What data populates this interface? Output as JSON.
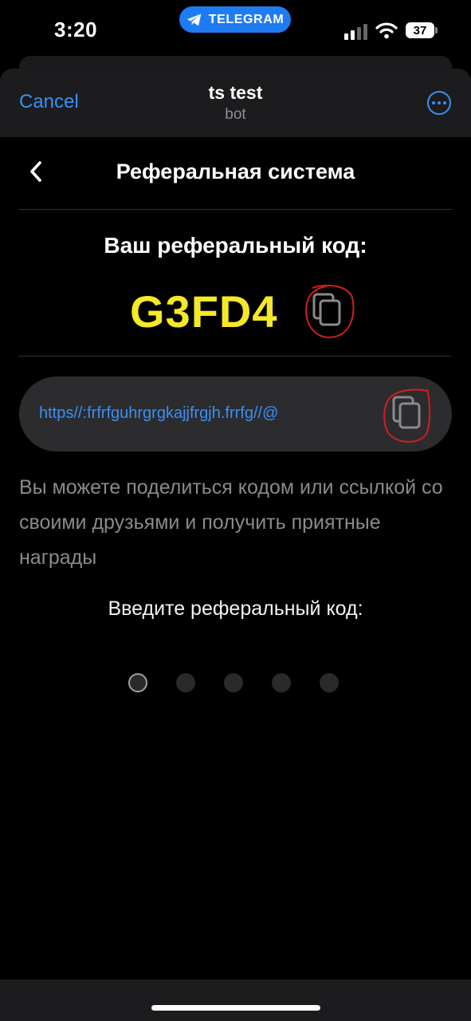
{
  "status_bar": {
    "time": "3:20",
    "telegram_pill": "TELEGRAM",
    "battery": "37",
    "signal_icon": "cellular-signal-icon",
    "wifi_icon": "wifi-icon"
  },
  "header": {
    "cancel": "Cancel",
    "bot_name": "ts test",
    "bot_subtitle": "bot",
    "more_icon": "more-options-icon"
  },
  "page": {
    "title": "Реферальная система",
    "code_label": "Ваш реферальный код:",
    "code_value": "G3FD4",
    "referral_link": "https//:frfrfguhrgrgkajjfrgjh.frrfg//@",
    "hint": "Вы можете поделиться кодом или ссылкой со своими друзьями и получить приятные награды",
    "enter_code_label": "Введите реферальный код:",
    "code_entry": {
      "total_digits": 5,
      "filled_digits": 0,
      "active_index": 0
    }
  },
  "colors": {
    "accent": "#3a8ff5",
    "code_yellow": "#f5e826",
    "annotation_red": "#d21e1e",
    "background": "#000000"
  }
}
